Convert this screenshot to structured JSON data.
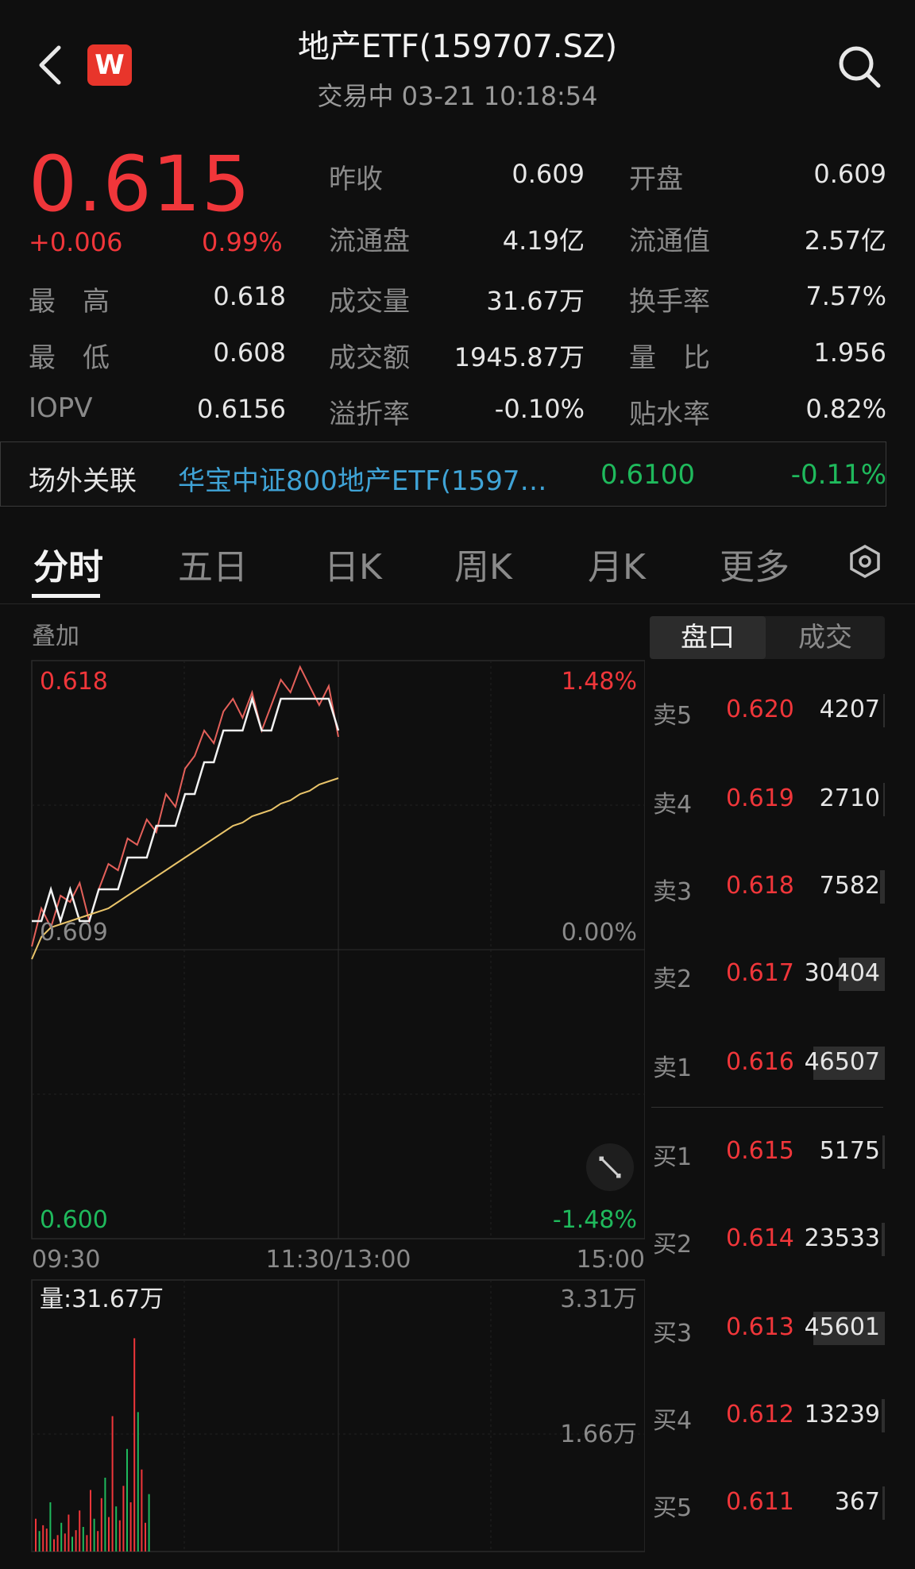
{
  "header": {
    "logo_text": "W",
    "title": "地产ETF(159707.SZ)",
    "status": "交易中 03-21 10:18:54"
  },
  "quote": {
    "price": "0.615",
    "change": "+0.006",
    "change_pct": "0.99%",
    "fields": [
      {
        "label": "最　高",
        "value": "0.618"
      },
      {
        "label": "最　低",
        "value": "0.608"
      },
      {
        "label": "IOPV",
        "value": "0.6156"
      },
      {
        "label": "昨收",
        "value": "0.609"
      },
      {
        "label": "流通盘",
        "value": "4.19亿"
      },
      {
        "label": "成交量",
        "value": "31.67万"
      },
      {
        "label": "成交额",
        "value": "1945.87万"
      },
      {
        "label": "溢折率",
        "value": "-0.10%"
      },
      {
        "label": "开盘",
        "value": "0.609"
      },
      {
        "label": "流通值",
        "value": "2.57亿"
      },
      {
        "label": "换手率",
        "value": "7.57%"
      },
      {
        "label": "量　比",
        "value": "1.956"
      },
      {
        "label": "贴水率",
        "value": "0.82%"
      }
    ]
  },
  "related": {
    "label": "场外关联",
    "name": "华宝中证800地产ETF(1597…",
    "price": "0.6100",
    "change": "-0.11%"
  },
  "tabs": [
    "分时",
    "五日",
    "日K",
    "周K",
    "月K",
    "更多"
  ],
  "active_tab": "分时",
  "chart": {
    "overlay_label": "叠加",
    "price_high": "0.618",
    "price_base": "0.609",
    "price_low": "0.600",
    "pct_high": "1.48%",
    "pct_base": "0.00%",
    "pct_low": "-1.48%",
    "time_start": "09:30",
    "time_mid": "11:30/13:00",
    "time_end": "15:00",
    "volume_label": "量:31.67万",
    "vol_max": "3.31万",
    "vol_mid": "1.66万"
  },
  "chart_data": {
    "type": "line",
    "title": "",
    "x_range": [
      "09:30",
      "15:00"
    ],
    "ylim": [
      0.6,
      0.618
    ],
    "series": [
      {
        "values": [
          0.6092,
          0.6104,
          0.6098,
          0.6108,
          0.6106,
          0.6112,
          0.61,
          0.611,
          0.6118,
          0.6116,
          0.6126,
          0.6124,
          0.6132,
          0.6128,
          0.614,
          0.6136,
          0.6148,
          0.6152,
          0.616,
          0.6156,
          0.6166,
          0.617,
          0.6164,
          0.6172,
          0.616,
          0.6168,
          0.6176,
          0.6172,
          0.618,
          0.6174,
          0.6168,
          0.6174,
          0.6158
        ],
        "color": "#e4605a"
      },
      {
        "values": [
          0.61,
          0.61,
          0.611,
          0.61,
          0.611,
          0.61,
          0.61,
          0.611,
          0.611,
          0.611,
          0.612,
          0.612,
          0.612,
          0.613,
          0.613,
          0.613,
          0.614,
          0.614,
          0.615,
          0.615,
          0.616,
          0.616,
          0.616,
          0.617,
          0.616,
          0.616,
          0.617,
          0.617,
          0.617,
          0.617,
          0.617,
          0.617,
          0.616
        ],
        "color": "#f2f2f2"
      },
      {
        "values": [
          0.6088,
          0.6095,
          0.6098,
          0.6099,
          0.61,
          0.6101,
          0.6102,
          0.6103,
          0.6104,
          0.6106,
          0.6108,
          0.611,
          0.6112,
          0.6114,
          0.6116,
          0.6118,
          0.612,
          0.6122,
          0.6124,
          0.6126,
          0.6128,
          0.613,
          0.6131,
          0.6133,
          0.6134,
          0.6135,
          0.6137,
          0.6138,
          0.614,
          0.6141,
          0.6143,
          0.6144,
          0.6145
        ],
        "color": "#e9c46a"
      }
    ],
    "volume": {
      "ylim": [
        0,
        33100
      ],
      "values": [
        4000,
        2500,
        3200,
        2800,
        6000,
        1500,
        2000,
        3500,
        2200,
        4500,
        1800,
        2600,
        5000,
        3000,
        2000,
        7500,
        4000,
        2500,
        6500,
        9000,
        4200,
        16500,
        5500,
        3800,
        8000,
        12500,
        6000,
        26000,
        17000,
        10000,
        3500,
        7000
      ]
    }
  },
  "orderbook": {
    "tabs": [
      "盘口",
      "成交"
    ],
    "asks": [
      {
        "label": "卖5",
        "price": "0.620",
        "volume": "4207",
        "fill": 0.02
      },
      {
        "label": "卖4",
        "price": "0.619",
        "volume": "2710",
        "fill": 0.02
      },
      {
        "label": "卖3",
        "price": "0.618",
        "volume": "7582",
        "fill": 0.06
      },
      {
        "label": "卖2",
        "price": "0.617",
        "volume": "30404",
        "fill": 0.58
      },
      {
        "label": "卖1",
        "price": "0.616",
        "volume": "46507",
        "fill": 0.9
      }
    ],
    "bids": [
      {
        "label": "买1",
        "price": "0.615",
        "volume": "5175",
        "fill": 0.03
      },
      {
        "label": "买2",
        "price": "0.614",
        "volume": "23533",
        "fill": 0.04
      },
      {
        "label": "买3",
        "price": "0.613",
        "volume": "45601",
        "fill": 0.9
      },
      {
        "label": "买4",
        "price": "0.612",
        "volume": "13239",
        "fill": 0.04
      },
      {
        "label": "买5",
        "price": "0.611",
        "volume": "367",
        "fill": 0.03
      }
    ]
  }
}
